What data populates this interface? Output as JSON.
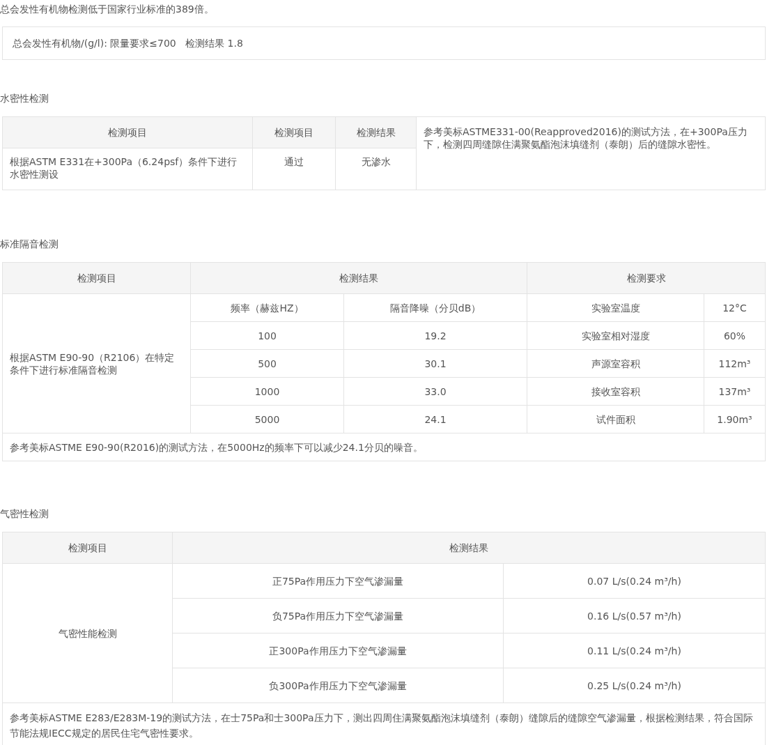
{
  "intro": "总会发性有机物检测低于国家行业标准的389倍。",
  "voc_box": "总会发性有机物/(g/l): 限量要求≤700   检测结果 1.8",
  "water": {
    "title": "水密性检测",
    "headers": [
      "检测项目",
      "检测项目",
      "检测结果"
    ],
    "row": [
      "根据ASTM E331在+300Pa（6.24psf）条件下进行水密性测设",
      "通过",
      "无渗水"
    ],
    "note": "参考美标ASTME331-00(Reapproved2016)的测试方法，在+300Pa压力下，检测四周缝隙住满聚氨酯泡沫填缝剂（泰朗）后的缝隙水密性。"
  },
  "sound": {
    "title": "标准隔音检测",
    "headers": [
      "检测项目",
      "检测结果",
      "检测要求"
    ],
    "item": "根据ASTM E90-90（R2106）在特定条件下进行标准隔音检测",
    "rows": [
      [
        "频率（赫兹HZ）",
        "隔音降噪（分贝dB）",
        "实验室温度",
        "12°C"
      ],
      [
        "100",
        "19.2",
        "实验室相对湿度",
        "60%"
      ],
      [
        "500",
        "30.1",
        "声源室容积",
        "112m³"
      ],
      [
        "1000",
        "33.0",
        "接收室容积",
        "137m³"
      ],
      [
        "5000",
        "24.1",
        "试件面积",
        "1.90m³"
      ]
    ],
    "note": "参考美标ASTME E90-90(R2016)的测试方法，在5000Hz的频率下可以减少24.1分贝的噪音。"
  },
  "air": {
    "title": "气密性检测",
    "headers": [
      "检测项目",
      "检测结果"
    ],
    "item": "气密性能检测",
    "rows": [
      [
        "正75Pa作用压力下空气渗漏量",
        "0.07 L/s(0.24 m³/h)"
      ],
      [
        "负75Pa作用压力下空气渗漏量",
        "0.16 L/s(0.57 m³/h)"
      ],
      [
        "正300Pa作用压力下空气渗漏量",
        "0.11 L/s(0.24 m³/h)"
      ],
      [
        "负300Pa作用压力下空气渗漏量",
        "0.25 L/s(0.24 m³/h)"
      ]
    ],
    "note": "参考美标ASTME E283/E283M-19的测试方法，在士75Pa和士300Pa压力下，测出四周住满聚氨酯泡沫填缝剂（泰朗）缝隙后的缝隙空气渗漏量，根据检测结果，符合国际节能法规IECC规定的居民住宅气密性要求。"
  }
}
